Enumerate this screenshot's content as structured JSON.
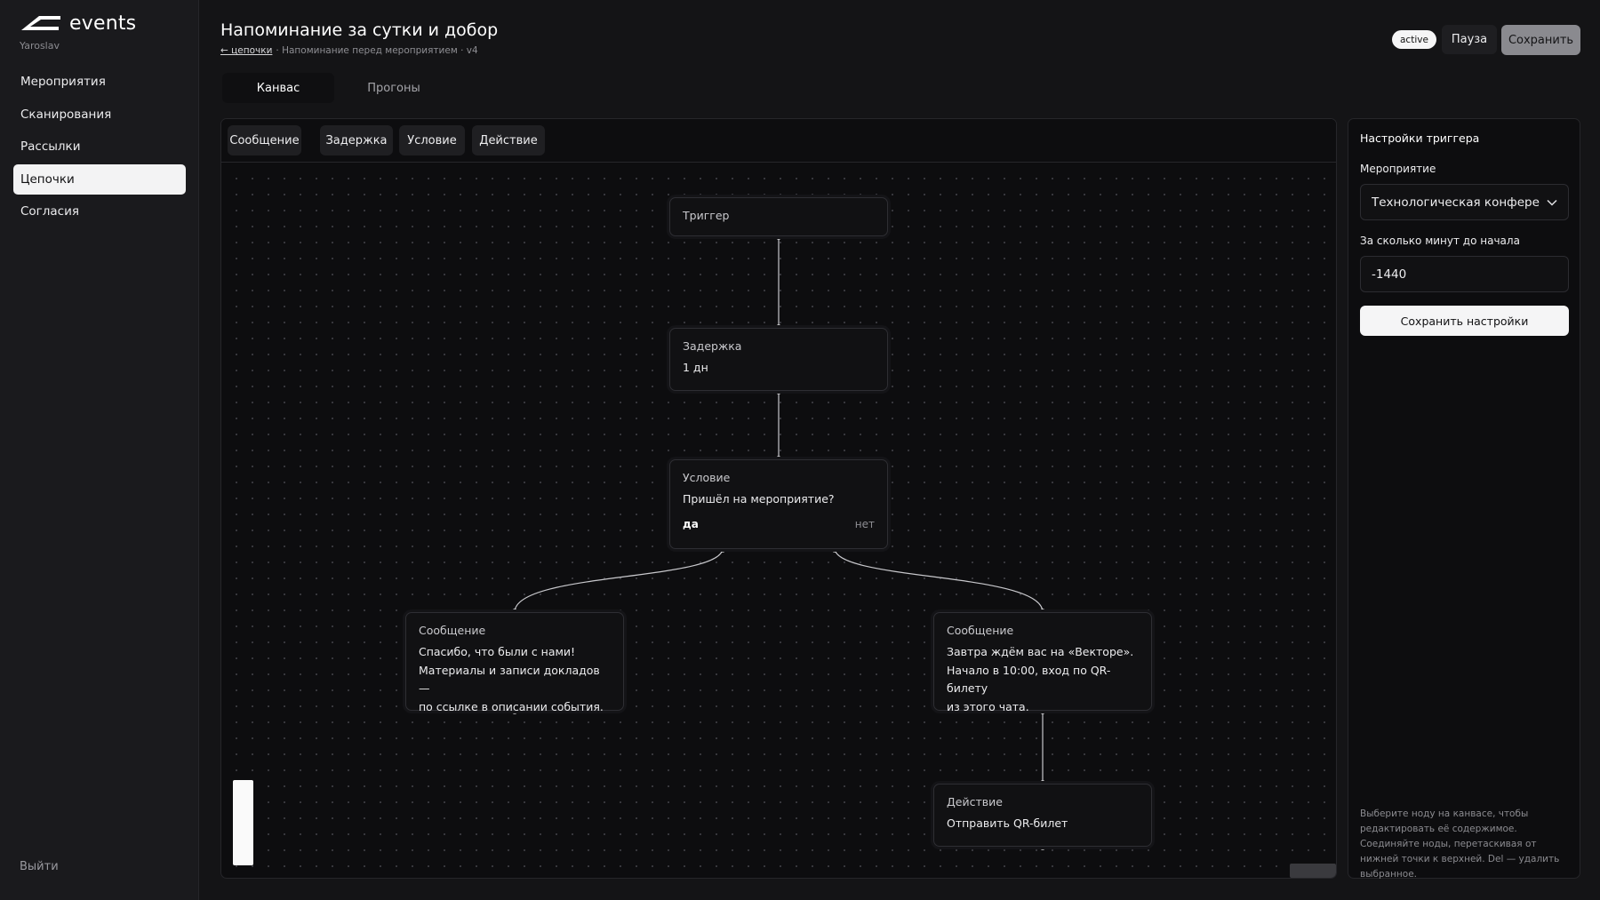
{
  "app": {
    "brand": "events",
    "user": "Yaroslav",
    "logout_label": "Выйти"
  },
  "sidebar": {
    "items": [
      {
        "label": "Мероприятия"
      },
      {
        "label": "Сканирования"
      },
      {
        "label": "Рассылки"
      },
      {
        "label": "Цепочки",
        "active": true
      },
      {
        "label": "Согласия"
      }
    ]
  },
  "header": {
    "title": "Напоминание за сутки и добор",
    "back_link": "← цепочки",
    "breadcrumb_rest": "· Напоминание перед мероприятием · v4",
    "status": "active",
    "pause_label": "Пауза",
    "save_label": "Сохранить"
  },
  "tabs": [
    {
      "label": "Канвас",
      "active": true
    },
    {
      "label": "Прогоны",
      "active": false
    }
  ],
  "toolbar": {
    "buttons": [
      "Сообщение",
      "Задержка",
      "Условие",
      "Действие"
    ]
  },
  "nodes": {
    "trigger": {
      "type": "Триггер"
    },
    "delay": {
      "type": "Задержка",
      "text": "1 дн"
    },
    "condition": {
      "type": "Условие",
      "text": "Пришёл на мероприятие?",
      "yes": "да",
      "no": "нет"
    },
    "message_yes": {
      "type": "Сообщение",
      "lines": [
        "Спасибо, что были с нами!",
        "Материалы и записи докладов —",
        "по ссылке в описании события."
      ]
    },
    "message_no": {
      "type": "Сообщение",
      "lines": [
        "Завтра ждём вас на «Векторе».",
        "Начало в 10:00, вход по QR-билету",
        "из этого чата."
      ]
    },
    "action": {
      "type": "Действие",
      "text": "Отправить QR-билет"
    }
  },
  "panel": {
    "title": "Настройки триггера",
    "event_label": "Мероприятие",
    "event_value": "Технологическая конфере",
    "minutes_label": "За сколько минут до начала",
    "minutes_value": "-1440",
    "save_settings_label": "Сохранить настройки",
    "hint": "Выберите ноду на канвасе, чтобы редактировать её содержимое. Соединяйте ноды, перетаскивая от нижней точки к верхней. Del — удалить выбранное."
  },
  "colors": {
    "background": "#141416",
    "sidebar": "#1a1a1d",
    "canvas": "#0d0d0f",
    "accent_light": "#f5f5f6",
    "save_button": "#8a8a8f"
  }
}
